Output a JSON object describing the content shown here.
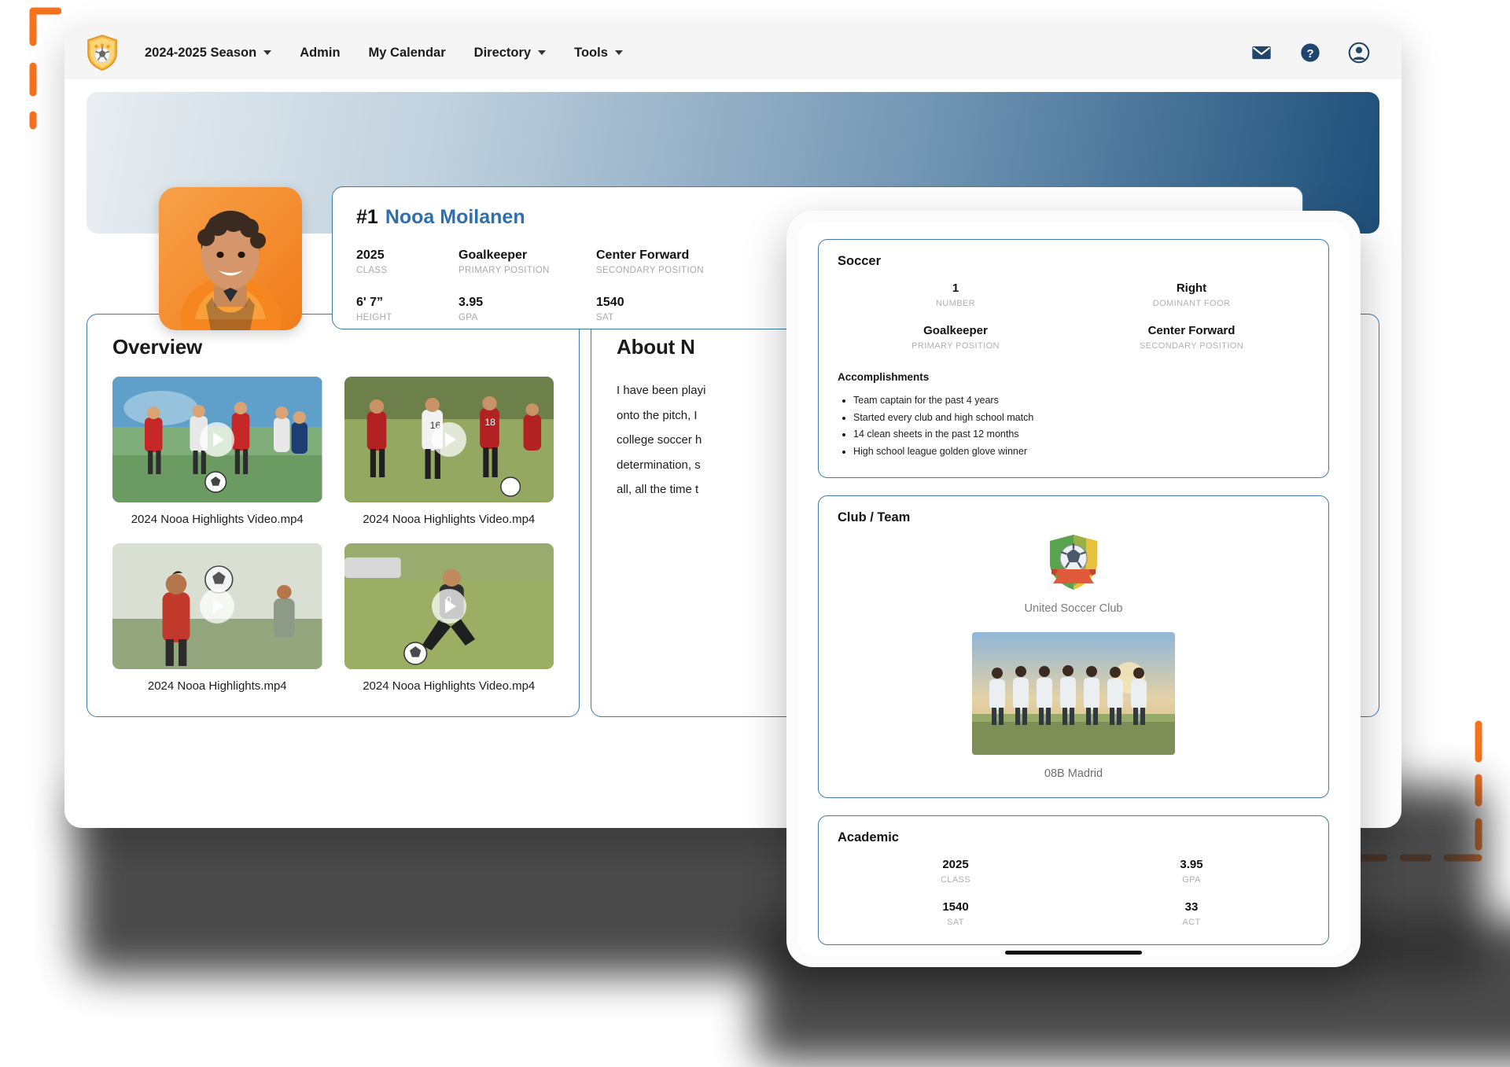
{
  "nav": {
    "logo_icon": "shield-soccer-logo",
    "items": [
      {
        "label": "2024-2025 Season",
        "has_caret": true
      },
      {
        "label": "Admin",
        "has_caret": false
      },
      {
        "label": "My Calendar",
        "has_caret": false
      },
      {
        "label": "Directory",
        "has_caret": true
      },
      {
        "label": "Tools",
        "has_caret": true
      }
    ],
    "right_icons": [
      "mail-icon",
      "help-icon",
      "user-avatar-icon"
    ]
  },
  "identity": {
    "number": "#1",
    "name": "Nooa Moilanen",
    "club": "United Soccer Club",
    "stats": [
      {
        "value": "2025",
        "label": "CLASS"
      },
      {
        "value": "Goalkeeper",
        "label": "PRIMARY POSITION"
      },
      {
        "value": "Center Forward",
        "label": "SECONDARY POSITION"
      },
      {
        "value": "6' 7”",
        "label": "HEIGHT"
      },
      {
        "value": "3.95",
        "label": "GPA"
      },
      {
        "value": "1540",
        "label": "SAT"
      }
    ]
  },
  "overview": {
    "title": "Overview",
    "videos": [
      {
        "caption": "2024 Nooa Highlights Video.mp4"
      },
      {
        "caption": "2024 Nooa Highlights Video.mp4"
      },
      {
        "caption": "2024 Nooa Highlights.mp4"
      },
      {
        "caption": "2024 Nooa Highlights Video.mp4"
      }
    ]
  },
  "about": {
    "title": "About N",
    "lines": [
      "I have been playi",
      "onto the pitch, I",
      "college soccer h",
      "determination, s",
      "all, all the time t"
    ]
  },
  "tablet": {
    "soccer": {
      "title": "Soccer",
      "stats": [
        {
          "value": "1",
          "label": "NUMBER"
        },
        {
          "value": "Right",
          "label": "DOMINANT FOOR"
        },
        {
          "value": "Goalkeeper",
          "label": "PRIMARY POSITION"
        },
        {
          "value": "Center Forward",
          "label": "SECONDARY POSITION"
        }
      ],
      "accomplishments_title": "Accomplishments",
      "accomplishments": [
        "Team captain for the past 4 years",
        "Started every club and high school match",
        "14 clean sheets in the past 12 months",
        "High school league golden glove winner"
      ]
    },
    "club": {
      "title": "Club / Team",
      "logo_icon": "club-shield-logo",
      "club_name": "United Soccer Club",
      "team_photo_caption": "08B Madrid"
    },
    "academic": {
      "title": "Academic",
      "stats": [
        {
          "value": "2025",
          "label": "CLASS"
        },
        {
          "value": "3.95",
          "label": "GPA"
        },
        {
          "value": "1540",
          "label": "SAT"
        },
        {
          "value": "33",
          "label": "ACT"
        }
      ]
    }
  },
  "colors": {
    "accent_blue": "#3f7ba6",
    "name_blue": "#2f6fae",
    "nav_icon_navy": "#21456c",
    "deco_orange": "#f5721f",
    "avatar_orange": "#f58220"
  }
}
